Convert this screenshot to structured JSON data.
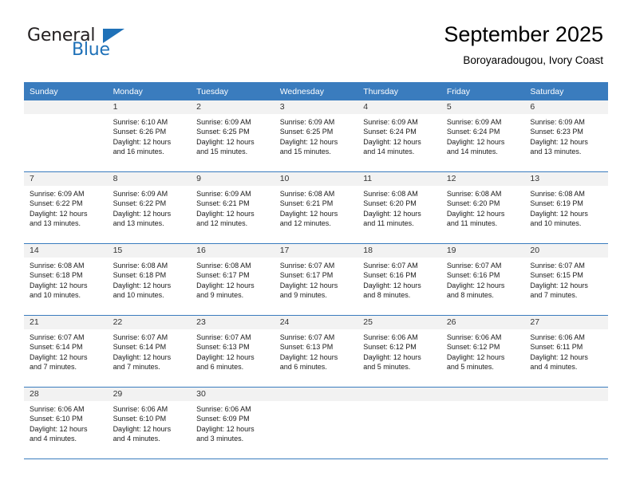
{
  "brand": {
    "name_part1": "General",
    "name_part2": "Blue",
    "accent_color": "#1f71b8"
  },
  "header": {
    "title": "September 2025",
    "subtitle": "Boroyaradougou, Ivory Coast"
  },
  "calendar": {
    "header_bg": "#3a7cbe",
    "daynum_bg": "#f2f2f2",
    "weekday_headers": [
      "Sunday",
      "Monday",
      "Tuesday",
      "Wednesday",
      "Thursday",
      "Friday",
      "Saturday"
    ],
    "weeks": [
      [
        {
          "day": "",
          "lines": []
        },
        {
          "day": "1",
          "lines": [
            "Sunrise: 6:10 AM",
            "Sunset: 6:26 PM",
            "Daylight: 12 hours",
            "and 16 minutes."
          ]
        },
        {
          "day": "2",
          "lines": [
            "Sunrise: 6:09 AM",
            "Sunset: 6:25 PM",
            "Daylight: 12 hours",
            "and 15 minutes."
          ]
        },
        {
          "day": "3",
          "lines": [
            "Sunrise: 6:09 AM",
            "Sunset: 6:25 PM",
            "Daylight: 12 hours",
            "and 15 minutes."
          ]
        },
        {
          "day": "4",
          "lines": [
            "Sunrise: 6:09 AM",
            "Sunset: 6:24 PM",
            "Daylight: 12 hours",
            "and 14 minutes."
          ]
        },
        {
          "day": "5",
          "lines": [
            "Sunrise: 6:09 AM",
            "Sunset: 6:24 PM",
            "Daylight: 12 hours",
            "and 14 minutes."
          ]
        },
        {
          "day": "6",
          "lines": [
            "Sunrise: 6:09 AM",
            "Sunset: 6:23 PM",
            "Daylight: 12 hours",
            "and 13 minutes."
          ]
        }
      ],
      [
        {
          "day": "7",
          "lines": [
            "Sunrise: 6:09 AM",
            "Sunset: 6:22 PM",
            "Daylight: 12 hours",
            "and 13 minutes."
          ]
        },
        {
          "day": "8",
          "lines": [
            "Sunrise: 6:09 AM",
            "Sunset: 6:22 PM",
            "Daylight: 12 hours",
            "and 13 minutes."
          ]
        },
        {
          "day": "9",
          "lines": [
            "Sunrise: 6:09 AM",
            "Sunset: 6:21 PM",
            "Daylight: 12 hours",
            "and 12 minutes."
          ]
        },
        {
          "day": "10",
          "lines": [
            "Sunrise: 6:08 AM",
            "Sunset: 6:21 PM",
            "Daylight: 12 hours",
            "and 12 minutes."
          ]
        },
        {
          "day": "11",
          "lines": [
            "Sunrise: 6:08 AM",
            "Sunset: 6:20 PM",
            "Daylight: 12 hours",
            "and 11 minutes."
          ]
        },
        {
          "day": "12",
          "lines": [
            "Sunrise: 6:08 AM",
            "Sunset: 6:20 PM",
            "Daylight: 12 hours",
            "and 11 minutes."
          ]
        },
        {
          "day": "13",
          "lines": [
            "Sunrise: 6:08 AM",
            "Sunset: 6:19 PM",
            "Daylight: 12 hours",
            "and 10 minutes."
          ]
        }
      ],
      [
        {
          "day": "14",
          "lines": [
            "Sunrise: 6:08 AM",
            "Sunset: 6:18 PM",
            "Daylight: 12 hours",
            "and 10 minutes."
          ]
        },
        {
          "day": "15",
          "lines": [
            "Sunrise: 6:08 AM",
            "Sunset: 6:18 PM",
            "Daylight: 12 hours",
            "and 10 minutes."
          ]
        },
        {
          "day": "16",
          "lines": [
            "Sunrise: 6:08 AM",
            "Sunset: 6:17 PM",
            "Daylight: 12 hours",
            "and 9 minutes."
          ]
        },
        {
          "day": "17",
          "lines": [
            "Sunrise: 6:07 AM",
            "Sunset: 6:17 PM",
            "Daylight: 12 hours",
            "and 9 minutes."
          ]
        },
        {
          "day": "18",
          "lines": [
            "Sunrise: 6:07 AM",
            "Sunset: 6:16 PM",
            "Daylight: 12 hours",
            "and 8 minutes."
          ]
        },
        {
          "day": "19",
          "lines": [
            "Sunrise: 6:07 AM",
            "Sunset: 6:16 PM",
            "Daylight: 12 hours",
            "and 8 minutes."
          ]
        },
        {
          "day": "20",
          "lines": [
            "Sunrise: 6:07 AM",
            "Sunset: 6:15 PM",
            "Daylight: 12 hours",
            "and 7 minutes."
          ]
        }
      ],
      [
        {
          "day": "21",
          "lines": [
            "Sunrise: 6:07 AM",
            "Sunset: 6:14 PM",
            "Daylight: 12 hours",
            "and 7 minutes."
          ]
        },
        {
          "day": "22",
          "lines": [
            "Sunrise: 6:07 AM",
            "Sunset: 6:14 PM",
            "Daylight: 12 hours",
            "and 7 minutes."
          ]
        },
        {
          "day": "23",
          "lines": [
            "Sunrise: 6:07 AM",
            "Sunset: 6:13 PM",
            "Daylight: 12 hours",
            "and 6 minutes."
          ]
        },
        {
          "day": "24",
          "lines": [
            "Sunrise: 6:07 AM",
            "Sunset: 6:13 PM",
            "Daylight: 12 hours",
            "and 6 minutes."
          ]
        },
        {
          "day": "25",
          "lines": [
            "Sunrise: 6:06 AM",
            "Sunset: 6:12 PM",
            "Daylight: 12 hours",
            "and 5 minutes."
          ]
        },
        {
          "day": "26",
          "lines": [
            "Sunrise: 6:06 AM",
            "Sunset: 6:12 PM",
            "Daylight: 12 hours",
            "and 5 minutes."
          ]
        },
        {
          "day": "27",
          "lines": [
            "Sunrise: 6:06 AM",
            "Sunset: 6:11 PM",
            "Daylight: 12 hours",
            "and 4 minutes."
          ]
        }
      ],
      [
        {
          "day": "28",
          "lines": [
            "Sunrise: 6:06 AM",
            "Sunset: 6:10 PM",
            "Daylight: 12 hours",
            "and 4 minutes."
          ]
        },
        {
          "day": "29",
          "lines": [
            "Sunrise: 6:06 AM",
            "Sunset: 6:10 PM",
            "Daylight: 12 hours",
            "and 4 minutes."
          ]
        },
        {
          "day": "30",
          "lines": [
            "Sunrise: 6:06 AM",
            "Sunset: 6:09 PM",
            "Daylight: 12 hours",
            "and 3 minutes."
          ]
        },
        {
          "day": "",
          "lines": []
        },
        {
          "day": "",
          "lines": []
        },
        {
          "day": "",
          "lines": []
        },
        {
          "day": "",
          "lines": []
        }
      ]
    ]
  }
}
